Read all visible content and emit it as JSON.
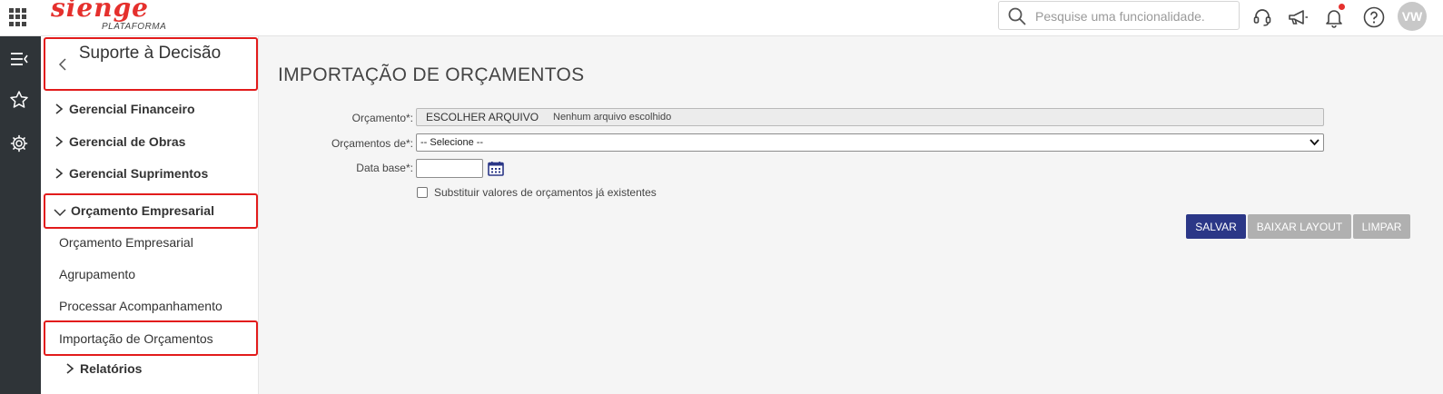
{
  "header": {
    "logo_text": "sienge",
    "logo_subtext": "PLATAFORMA",
    "search": {
      "placeholder": "Pesquise uma funcionalidade."
    },
    "icons": [
      "support-headset-icon",
      "megaphone-icon",
      "bell-icon",
      "help-icon"
    ],
    "avatar_initials": "VW",
    "notification_color": "#e5302d"
  },
  "rail": {
    "icons": [
      "menu-collapse-icon",
      "star-icon",
      "gear-icon"
    ]
  },
  "sidebar": {
    "title": "Suporte à Decisão",
    "groups": [
      {
        "label": "Gerencial Financeiro"
      },
      {
        "label": "Gerencial de Obras"
      },
      {
        "label": "Gerencial Suprimentos"
      },
      {
        "label": "Orçamento Empresarial"
      }
    ],
    "subitems": [
      {
        "label": "Orçamento Empresarial"
      },
      {
        "label": "Agrupamento"
      },
      {
        "label": "Processar Acompanhamento"
      },
      {
        "label": "Importação de Orçamentos"
      }
    ],
    "reports_label": "Relatórios"
  },
  "main": {
    "title": "IMPORTAÇÃO DE ORÇAMENTOS",
    "form": {
      "orcamento_label": "Orçamento*:",
      "file_button": "ESCOLHER ARQUIVO",
      "file_status": "Nenhum arquivo escolhido",
      "orcamentos_de_label": "Orçamentos de*:",
      "orcamentos_de_value": "-- Selecione --",
      "data_base_label": "Data base*:",
      "data_base_value": "",
      "replace_label": "Substituir valores de orçamentos já existentes"
    },
    "buttons": {
      "save": "SALVAR",
      "download_layout": "BAIXAR LAYOUT",
      "clear": "LIMPAR"
    },
    "colors": {
      "primary": "#2b3787",
      "disabled": "#b0b0b0",
      "highlight": "#e21b1b"
    }
  }
}
